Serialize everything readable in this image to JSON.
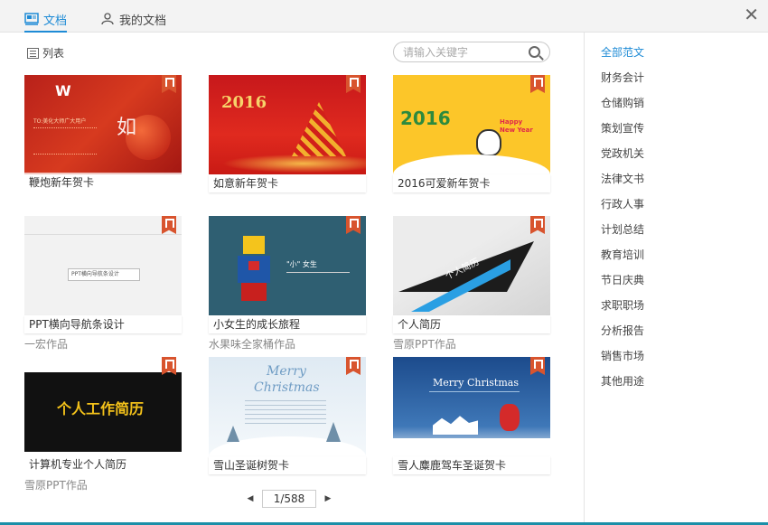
{
  "tabs": [
    {
      "label": "文档",
      "active": true
    },
    {
      "label": "我的文档",
      "active": false
    }
  ],
  "toolbar": {
    "list_label": "列表"
  },
  "search": {
    "placeholder": "请输入关键字"
  },
  "cards": [
    {
      "title": "鞭炮新年贺卡",
      "author": ""
    },
    {
      "title": "如意新年贺卡",
      "author": ""
    },
    {
      "title": "2016可爱新年贺卡",
      "author": ""
    },
    {
      "title": "PPT横向导航条设计",
      "author": "一宏作品"
    },
    {
      "title": "小女生的成长旅程",
      "author": "水果味全家桶作品"
    },
    {
      "title": "个人简历",
      "author": "雪原PPT作品"
    },
    {
      "title": "计算机专业个人简历",
      "author": "雪原PPT作品"
    },
    {
      "title": "雪山圣诞树贺卡",
      "author": ""
    },
    {
      "title": "雪人麋鹿驾车圣诞贺卡",
      "author": ""
    }
  ],
  "thumb_text": {
    "c1_brand": "W",
    "c1_to": "TO:美化大师广大用户",
    "c2_year": "2016",
    "c3_year": "2016",
    "c3_happy": "Happy New Year",
    "c4_nav": "PPT横向导航条设计",
    "c5_title": "\"小\" 女生",
    "c6_title": "个人简历",
    "c7_title": "个人工作简历",
    "c8_merry": "Merry",
    "c8_christmas": "Christmas",
    "c9_title": "Merry Christmas"
  },
  "pagination": {
    "current": "1/588"
  },
  "categories": [
    {
      "label": "全部范文",
      "active": true
    },
    {
      "label": "财务会计"
    },
    {
      "label": "仓储购销"
    },
    {
      "label": "策划宣传"
    },
    {
      "label": "党政机关"
    },
    {
      "label": "法律文书"
    },
    {
      "label": "行政人事"
    },
    {
      "label": "计划总结"
    },
    {
      "label": "教育培训"
    },
    {
      "label": "节日庆典"
    },
    {
      "label": "求职职场"
    },
    {
      "label": "分析报告"
    },
    {
      "label": "销售市场"
    },
    {
      "label": "其他用途"
    }
  ],
  "colors": {
    "accent": "#1e8bd6",
    "badge": "#d8542e"
  }
}
